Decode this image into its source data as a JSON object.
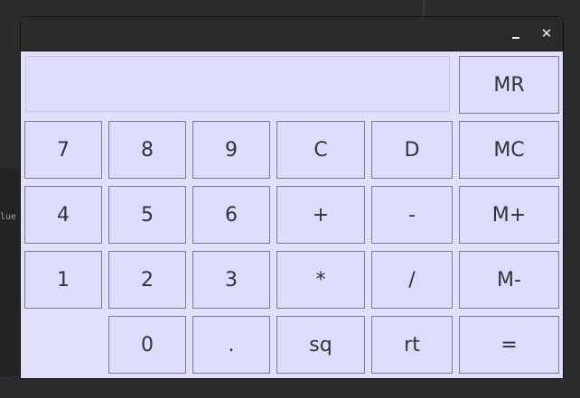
{
  "background": {
    "text_fragment": "lue"
  },
  "titlebar": {
    "minimize_icon": "minimize-icon",
    "close_icon": "close-icon",
    "close_glyph": "✕"
  },
  "display": {
    "value": ""
  },
  "keys": [
    {
      "label": "MR"
    },
    {
      "label": "7"
    },
    {
      "label": "8"
    },
    {
      "label": "9"
    },
    {
      "label": "C"
    },
    {
      "label": "D"
    },
    {
      "label": "MC"
    },
    {
      "label": "4"
    },
    {
      "label": "5"
    },
    {
      "label": "6"
    },
    {
      "label": "+"
    },
    {
      "label": "-"
    },
    {
      "label": "M+"
    },
    {
      "label": "1"
    },
    {
      "label": "2"
    },
    {
      "label": "3"
    },
    {
      "label": "*"
    },
    {
      "label": "/"
    },
    {
      "label": "M-"
    },
    {
      "label": "0"
    },
    {
      "label": "."
    },
    {
      "label": "sq"
    },
    {
      "label": "rt"
    },
    {
      "label": "="
    }
  ],
  "colors": {
    "window_bg": "#e0e0fb",
    "key_bg": "#dcdcfc",
    "key_border": "#7a7a8e",
    "titlebar_bg": "#2a2a2a",
    "desktop_bg": "#2b2b2b"
  }
}
